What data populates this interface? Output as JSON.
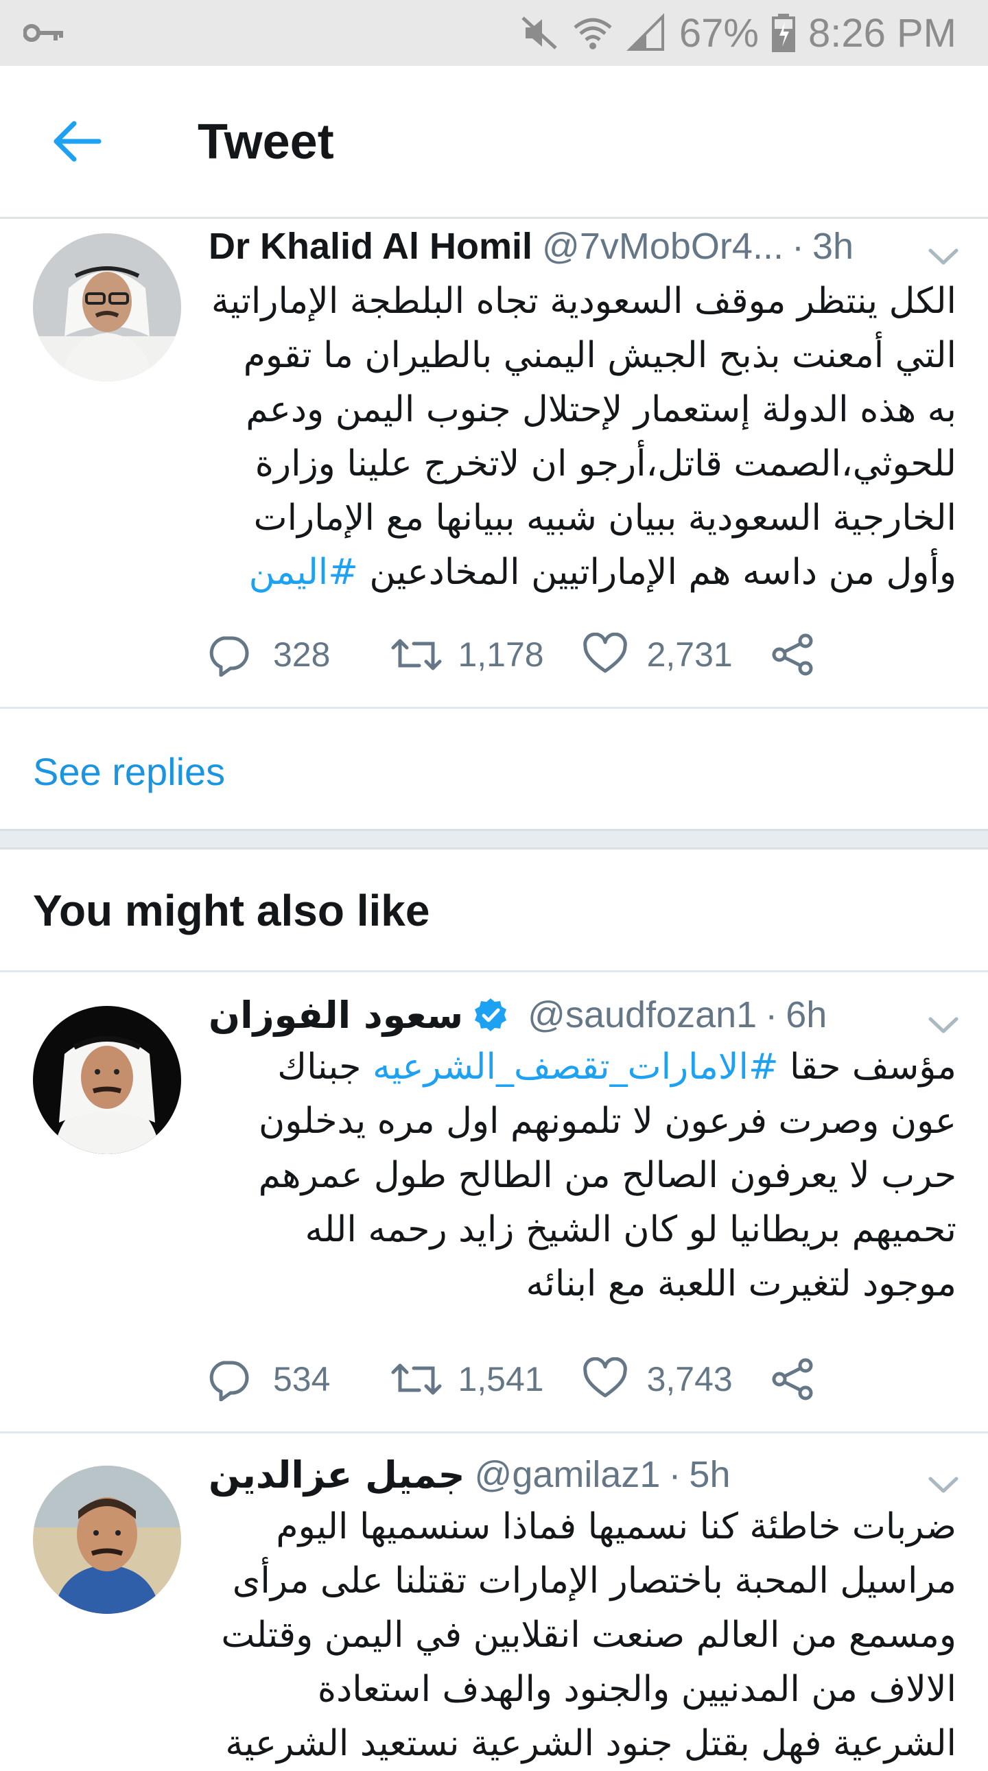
{
  "status_bar": {
    "battery": "67%",
    "time": "8:26 PM",
    "icons": [
      "key-icon",
      "mute-icon",
      "wifi-icon",
      "signal-icon",
      "battery-icon"
    ]
  },
  "header": {
    "title": "Tweet",
    "back_icon": "arrow-left-icon"
  },
  "colors": {
    "accent": "#1da1f2",
    "link": "#1b95e0",
    "text": "#14171a",
    "secondary": "#657786",
    "separator": "#e1e8ed"
  },
  "main_tweet": {
    "name": "Dr Khalid Al Homil",
    "handle": "@7vMobOr4...",
    "time": "3h",
    "text": "الكل ينتظر موقف السعودية تجاه البلطجة الإماراتية التي أمعنت بذبح الجيش اليمني بالطيران ما تقوم به هذه الدولة إستعمار لإحتلال جنوب اليمن ودعم للحوثي،الصمت قاتل،أرجو ان لاتخرج علينا وزارة الخارجية السعودية ببيان شبيه ببيانها مع الإمارات وأول من داسه هم الإماراتيين المخادعين",
    "hashtag": "#اليمن",
    "replies": "328",
    "retweets": "1,178",
    "likes": "2,731"
  },
  "see_replies": "See replies",
  "section_title": "You might also like",
  "suggested": [
    {
      "name": "سعود الفوزان",
      "verified": true,
      "handle": "@saudfozan1",
      "time": "6h",
      "text_before": "مؤسف حقا ",
      "hashtag": "#الامارات_تقصف_الشرعيه",
      "text_after": " جبناك عون وصرت فرعون لا تلمونهم اول مره يدخلون حرب لا يعرفون الصالح من الطالح طول عمرهم تحميهم بريطانيا لو كان الشيخ زايد رحمه الله موجود لتغيرت اللعبة مع ابنائه",
      "replies": "534",
      "retweets": "1,541",
      "likes": "3,743"
    },
    {
      "name": "جميل عزالدين",
      "verified": false,
      "handle": "@gamilaz1",
      "time": "5h",
      "text": "ضربات خاطئة كنا نسميها فماذا سنسميها اليوم مراسيل المحبة  باختصار الإمارات تقتلنا على مرأى ومسمع من العالم  صنعت انقلابين في اليمن وقتلت الالاف من المدنيين والجنود  والهدف استعادة الشرعية فهل بقتل جنود الشرعية نستعيد الشرعية"
    }
  ]
}
